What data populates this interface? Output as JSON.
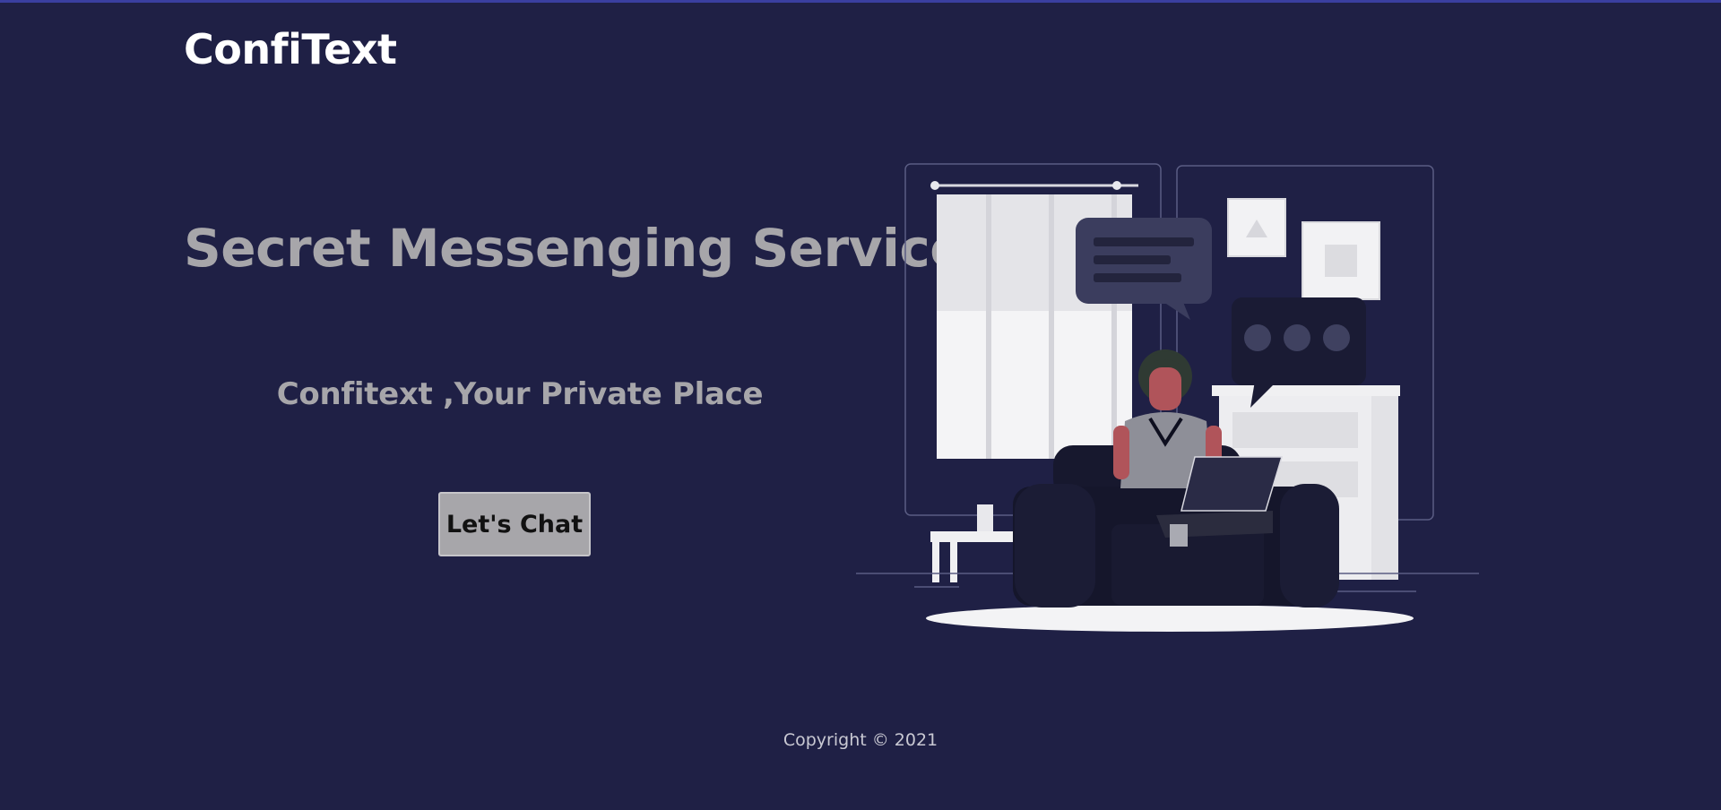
{
  "header": {
    "brand": "ConfiText"
  },
  "hero": {
    "title": "Secret Messenging Service",
    "subtitle": "Confitext ,Your Private Place",
    "cta_label": "Let's Chat"
  },
  "footer": {
    "copyright": "Copyright © 2021"
  },
  "colors": {
    "background": "#1f2045",
    "accent_line": "#3a3fa0",
    "heading": "#a7a6aa",
    "brand": "#ffffff"
  }
}
